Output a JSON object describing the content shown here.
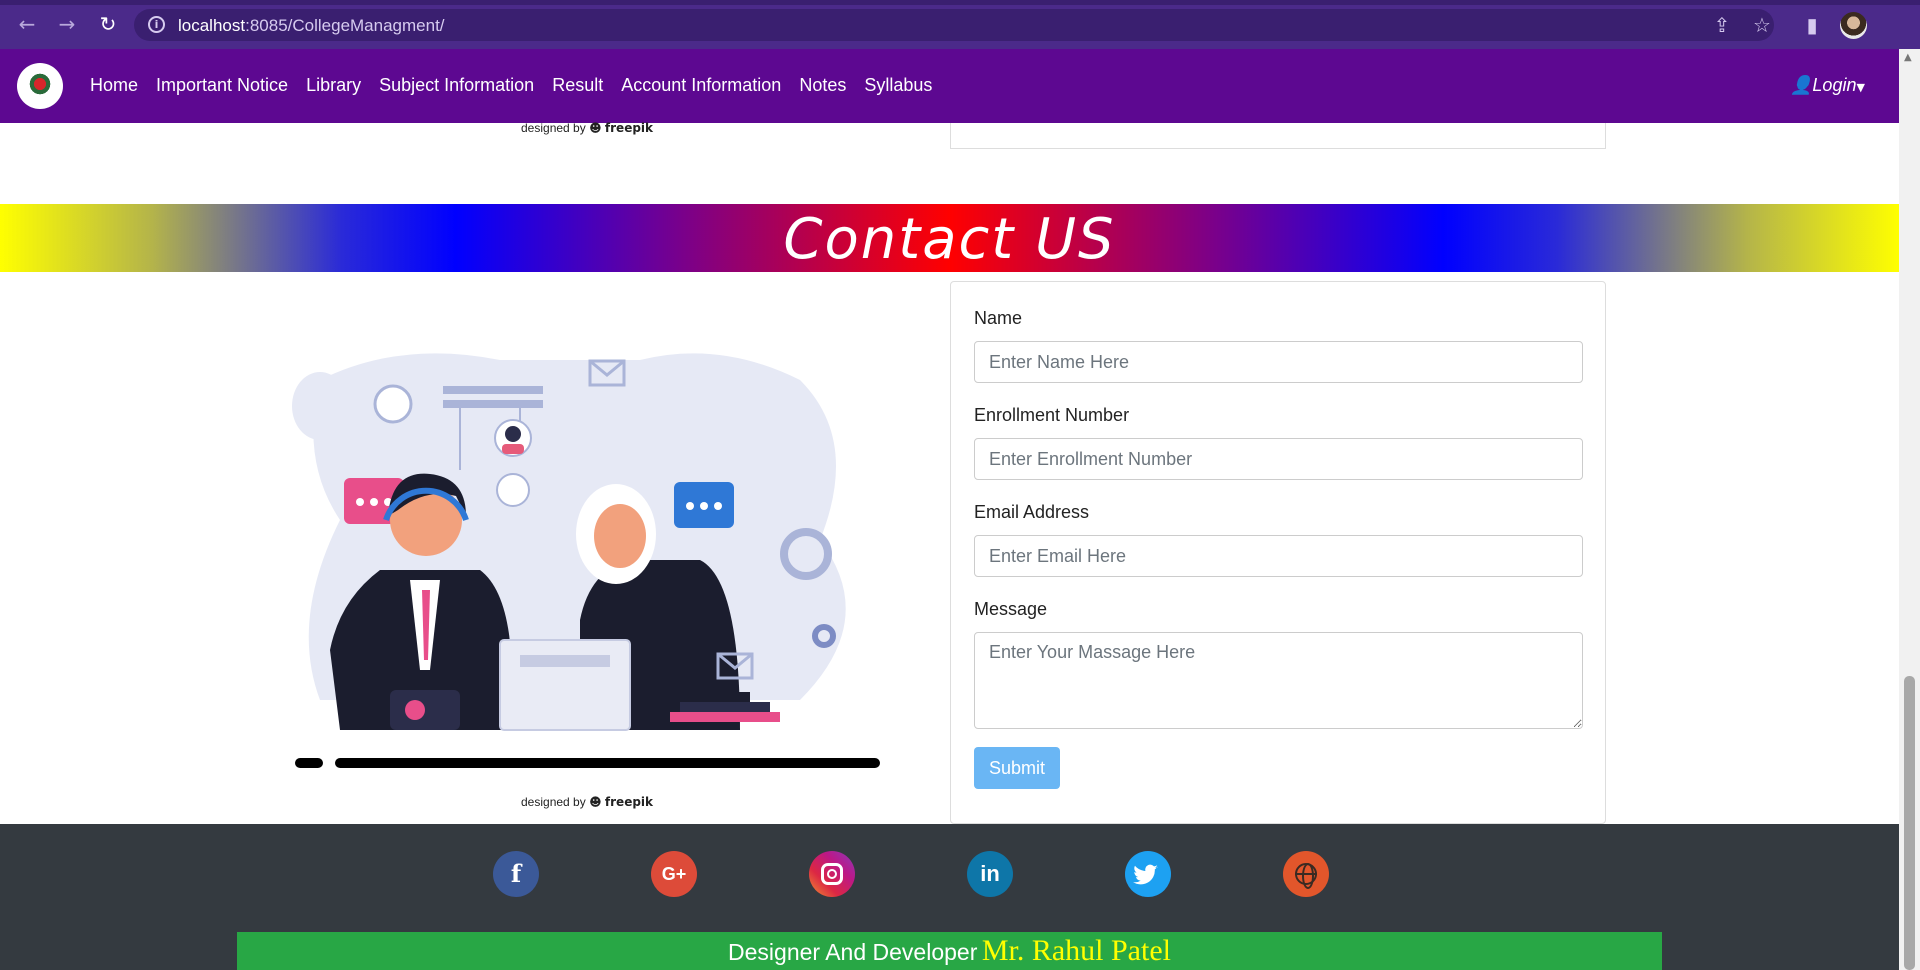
{
  "browser": {
    "url_host": "localhost",
    "url_path": ":8085/CollegeManagment/"
  },
  "navbar": {
    "items": [
      "Home",
      "Important Notice",
      "Library",
      "Subject Information",
      "Result",
      "Account Information",
      "Notes",
      "Syllabus"
    ],
    "login_label": "Login"
  },
  "prev_section": {
    "credit_prefix": "designed by",
    "credit_brand": "freepik"
  },
  "contact": {
    "heading": "Contact US",
    "illustration_credit_prefix": "designed by",
    "illustration_credit_brand": "freepik",
    "form": {
      "name_label": "Name",
      "name_placeholder": "Enter Name Here",
      "enrollment_label": "Enrollment Number",
      "enrollment_placeholder": "Enter Enrollment Number",
      "email_label": "Email Address",
      "email_placeholder": "Enter Email Here",
      "message_label": "Message",
      "message_placeholder": "Enter Your Massage Here",
      "submit_label": "Submit"
    }
  },
  "footer": {
    "social_icons": [
      "facebook-icon",
      "google-plus-icon",
      "instagram-icon",
      "linkedin-icon",
      "twitter-icon",
      "globe-icon"
    ],
    "credit_lead": "Designer And Developer",
    "credit_name": "Mr. Rahul Patel"
  },
  "colors": {
    "navbar": "#5d0891",
    "footer": "#343a40",
    "credit_bar": "#28a745",
    "submit": "#6ab6f4"
  }
}
